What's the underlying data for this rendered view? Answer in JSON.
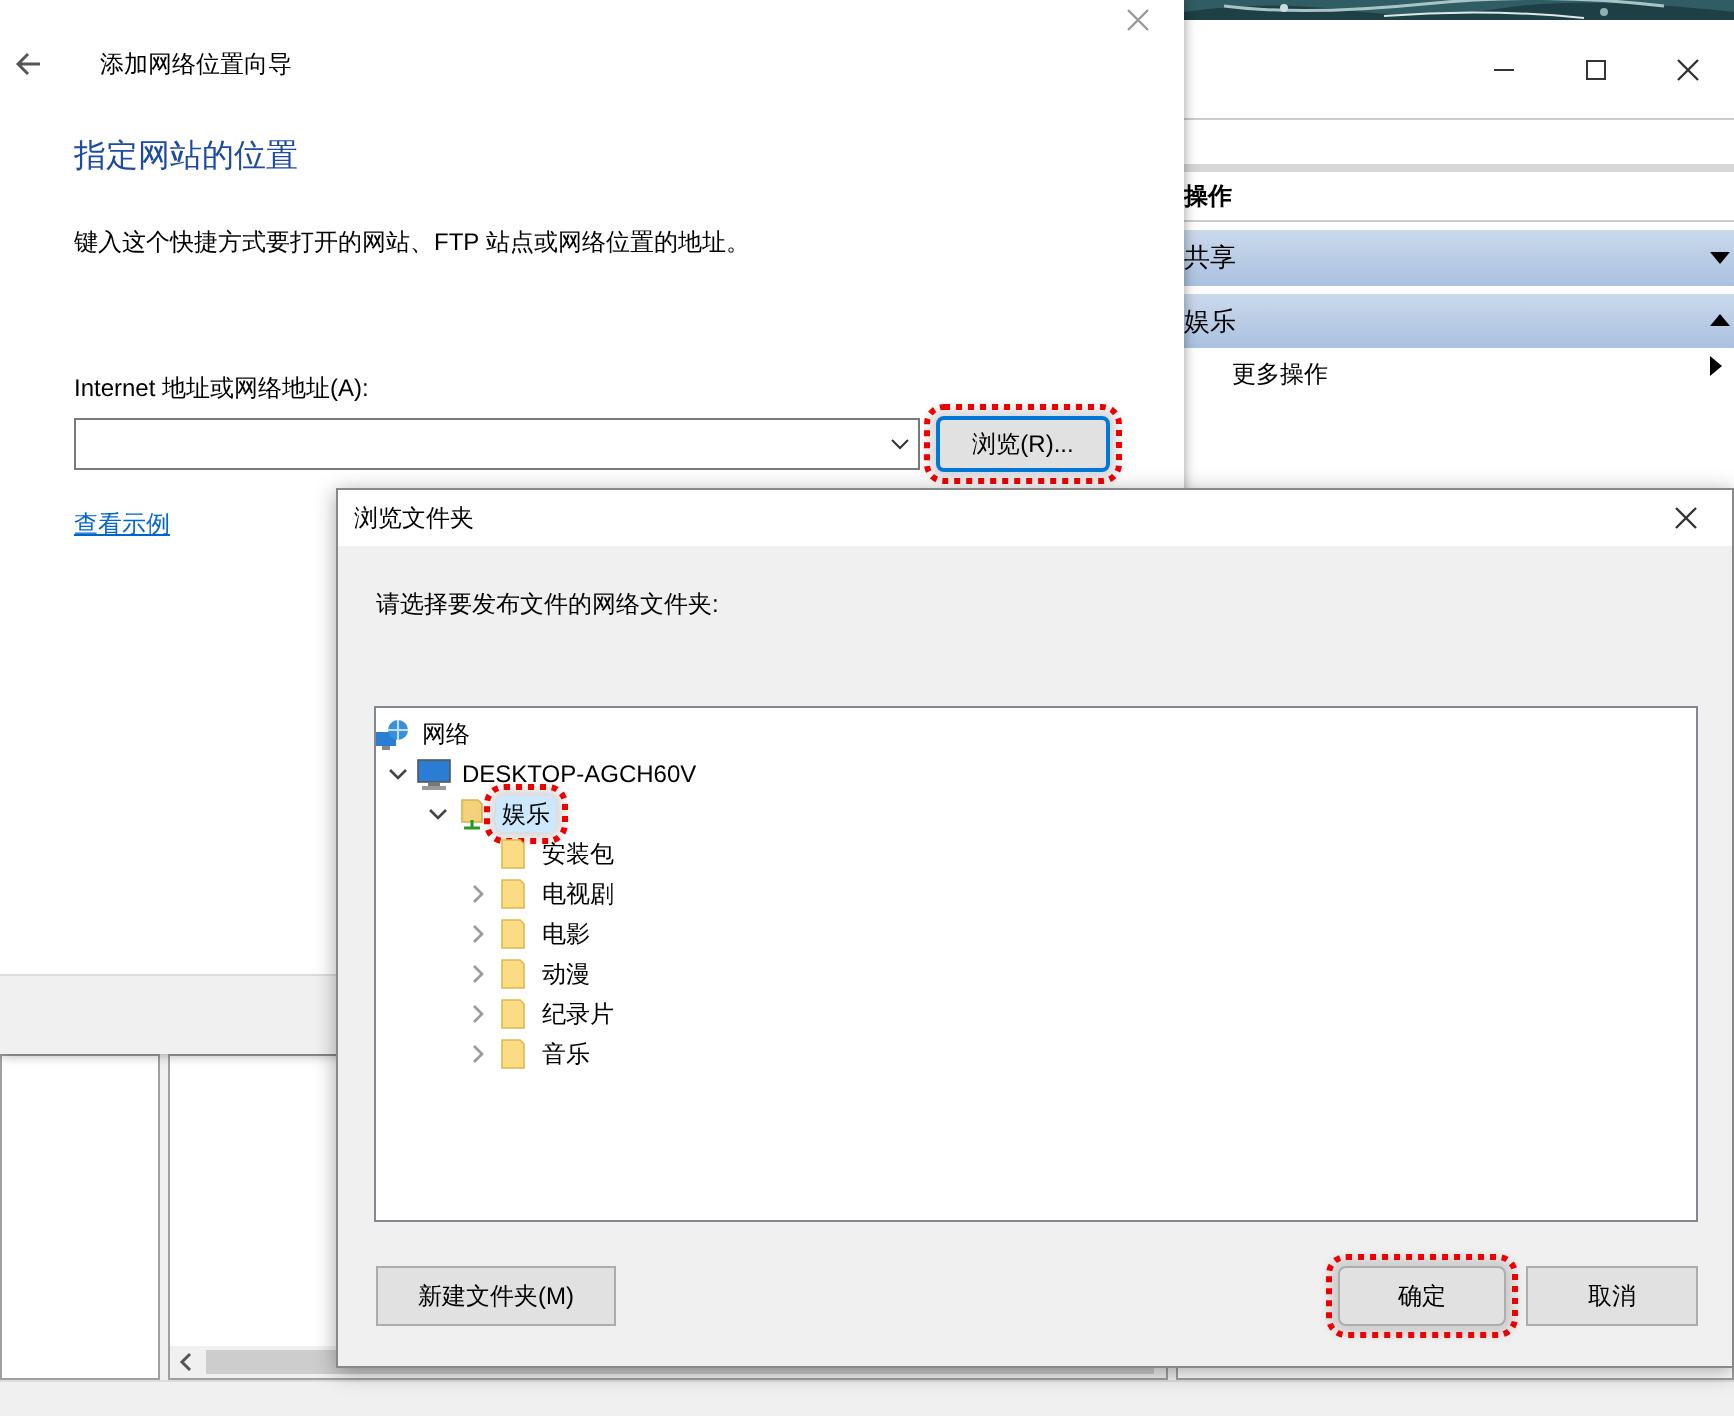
{
  "background_window": {
    "actions": {
      "header": "操作",
      "groups": [
        {
          "label": "共享",
          "expanded": false
        },
        {
          "label": "娱乐",
          "expanded": true
        }
      ],
      "items": [
        {
          "label": "更多操作"
        }
      ]
    }
  },
  "wizard": {
    "title": "添加网络位置向导",
    "heading": "指定网站的位置",
    "description": "键入这个快捷方式要打开的网站、FTP 站点或网络位置的地址。",
    "address_label": "Internet 地址或网络地址(A):",
    "browse_button": {
      "label": "浏览(R)...",
      "highlighted": true
    },
    "example_link": "查看示例"
  },
  "browse_dialog": {
    "title": "浏览文件夹",
    "prompt": "请选择要发布文件的网络文件夹:",
    "tree": [
      {
        "label": "网络",
        "kind": "network",
        "selected": false,
        "highlighted": false,
        "children": [
          {
            "label": "DESKTOP-AGCH60V",
            "kind": "computer",
            "expanded": true,
            "selected": false,
            "highlighted": false,
            "children": [
              {
                "label": "娱乐",
                "kind": "share",
                "expanded": true,
                "selected": true,
                "highlighted": true,
                "children": [
                  {
                    "label": "安装包",
                    "kind": "folder",
                    "selected": false,
                    "highlighted": false
                  },
                  {
                    "label": "电视剧",
                    "kind": "folder",
                    "expanded": false,
                    "selected": false,
                    "highlighted": false
                  },
                  {
                    "label": "电影",
                    "kind": "folder",
                    "expanded": false,
                    "selected": false,
                    "highlighted": false
                  },
                  {
                    "label": "动漫",
                    "kind": "folder",
                    "expanded": false,
                    "selected": false,
                    "highlighted": false
                  },
                  {
                    "label": "纪录片",
                    "kind": "folder",
                    "expanded": false,
                    "selected": false,
                    "highlighted": false
                  },
                  {
                    "label": "音乐",
                    "kind": "folder",
                    "expanded": false,
                    "selected": false,
                    "highlighted": false
                  }
                ]
              }
            ]
          }
        ]
      }
    ],
    "buttons": [
      {
        "label": "新建文件夹(M)",
        "kind": "new_folder",
        "highlighted": false
      },
      {
        "label": "确定",
        "kind": "ok",
        "highlighted": true
      },
      {
        "label": "取消",
        "kind": "cancel",
        "highlighted": false
      }
    ]
  }
}
